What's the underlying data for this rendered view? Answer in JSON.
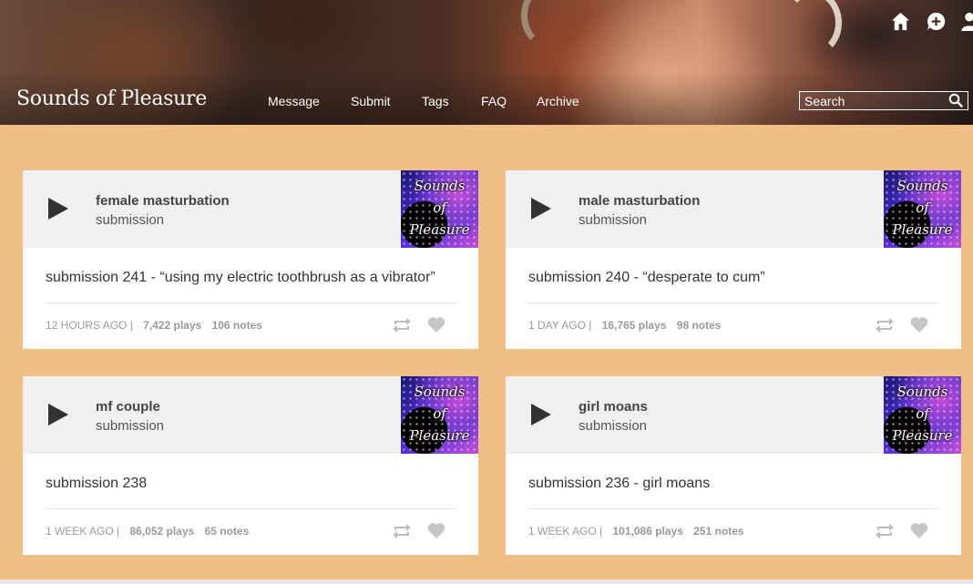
{
  "header": {
    "site_title": "Sounds of Pleasure",
    "nav": [
      "Message",
      "Submit",
      "Tags",
      "FAQ",
      "Archive"
    ],
    "search_placeholder": "Search"
  },
  "posts": [
    {
      "track_title": "female masturbation",
      "artist": "submission",
      "art": [
        "Sounds",
        "of",
        "Pleasure"
      ],
      "caption": "submission 241 - “using my electric toothbrush as a vibrator”",
      "time": "12 HOURS AGO |",
      "plays": "7,422 plays",
      "notes": "106 notes"
    },
    {
      "track_title": "male masturbation",
      "artist": "submission",
      "art": [
        "Sounds",
        "of",
        "Pleasure"
      ],
      "caption": "submission 240 - “desperate to cum”",
      "time": "1 DAY AGO |",
      "plays": "16,765 plays",
      "notes": "98 notes"
    },
    {
      "track_title": "mf couple",
      "artist": "submission",
      "art": [
        "Sounds",
        "of",
        "Pleasure"
      ],
      "caption": "submission 238",
      "time": "1 WEEK AGO |",
      "plays": "86,052 plays",
      "notes": "65 notes"
    },
    {
      "track_title": "girl moans",
      "artist": "submission",
      "art": [
        "Sounds",
        "of",
        "Pleasure"
      ],
      "caption": "submission 236 - girl moans",
      "time": "1 WEEK AGO |",
      "plays": "101,086 plays",
      "notes": "251 notes"
    }
  ],
  "colors": {
    "page_background": "#f0bf86",
    "card_background": "#ffffff",
    "player_background": "#f0f0f0",
    "meta_text": "#999999"
  },
  "icons": [
    "home-icon",
    "compose-icon",
    "user-icon",
    "search-icon",
    "play-icon",
    "reblog-icon",
    "heart-icon"
  ]
}
